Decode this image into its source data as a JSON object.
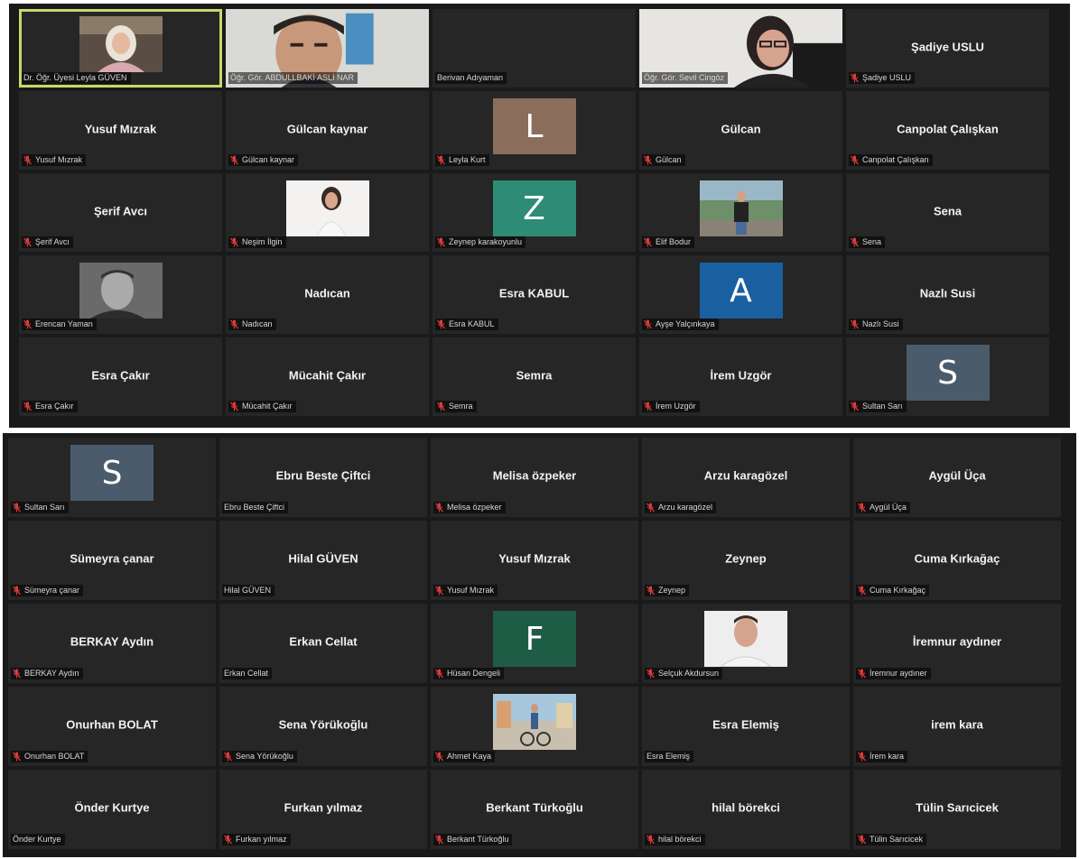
{
  "top_grid": [
    {
      "name": "",
      "label": "Dr. Öğr. Üyesi Leyla GÜVEN",
      "muted": false,
      "media": "photo",
      "active": true
    },
    {
      "name": "",
      "label": "Öğr. Gör. ABDULLBAKİ ASLİ NAR",
      "muted": false,
      "media": "video"
    },
    {
      "name": "",
      "label": "Berivan Adıyaman",
      "muted": false,
      "media": "none"
    },
    {
      "name": "",
      "label": "Öğr. Gör. Sevil Cingöz",
      "muted": false,
      "media": "video"
    },
    {
      "name": "Şadiye USLU",
      "label": "Şadiye USLU",
      "muted": true,
      "media": "none"
    },
    {
      "name": "Yusuf Mızrak",
      "label": "Yusuf Mızrak",
      "muted": true,
      "media": "none"
    },
    {
      "name": "Gülcan kaynar",
      "label": "Gülcan kaynar",
      "muted": true,
      "media": "none"
    },
    {
      "name": "",
      "label": "Leyla Kurt",
      "muted": true,
      "media": "initial",
      "initial": "L",
      "color": "#8b6d5c"
    },
    {
      "name": "Gülcan",
      "label": "Gülcan",
      "muted": true,
      "media": "none"
    },
    {
      "name": "Canpolat Çalışkan",
      "label": "Canpolat Çalışkan",
      "muted": true,
      "media": "none"
    },
    {
      "name": "Şerif Avcı",
      "label": "Şerif Avcı",
      "muted": true,
      "media": "none"
    },
    {
      "name": "",
      "label": "Neşim İlgin",
      "muted": true,
      "media": "photo"
    },
    {
      "name": "",
      "label": "Zeynep karakoyunlu",
      "muted": true,
      "media": "initial",
      "initial": "Z",
      "color": "#2e8b76"
    },
    {
      "name": "",
      "label": "Elif Bodur",
      "muted": true,
      "media": "photo"
    },
    {
      "name": "Sena",
      "label": "Sena",
      "muted": true,
      "media": "none"
    },
    {
      "name": "",
      "label": "Erencan Yaman",
      "muted": true,
      "media": "photo"
    },
    {
      "name": "Nadıcan",
      "label": "Nadıcan",
      "muted": true,
      "media": "none"
    },
    {
      "name": "Esra KABUL",
      "label": "Esra KABUL",
      "muted": true,
      "media": "none"
    },
    {
      "name": "",
      "label": "Ayşe Yalçınkaya",
      "muted": true,
      "media": "initial",
      "initial": "A",
      "color": "#1a5fa0"
    },
    {
      "name": "Nazlı Susi",
      "label": "Nazlı Susi",
      "muted": true,
      "media": "none"
    },
    {
      "name": "Esra Çakır",
      "label": "Esra Çakır",
      "muted": true,
      "media": "none"
    },
    {
      "name": "Mücahit Çakır",
      "label": "Mücahit Çakır",
      "muted": true,
      "media": "none"
    },
    {
      "name": "Semra",
      "label": "Semra",
      "muted": true,
      "media": "none"
    },
    {
      "name": "İrem Uzgör",
      "label": "İrem Uzgör",
      "muted": true,
      "media": "none"
    },
    {
      "name": "",
      "label": "Sultan Sarı",
      "muted": true,
      "media": "initial",
      "initial": "S",
      "color": "#4a5c6b"
    }
  ],
  "bottom_grid": [
    {
      "name": "",
      "label": "Sultan Sarı",
      "muted": true,
      "media": "initial",
      "initial": "S",
      "color": "#4a5c6b"
    },
    {
      "name": "Ebru Beste Çiftci",
      "label": "Ebru Beste Çiftci",
      "muted": false,
      "media": "none"
    },
    {
      "name": "Melisa özpeker",
      "label": "Melisa özpeker",
      "muted": true,
      "media": "none"
    },
    {
      "name": "Arzu karagözel",
      "label": "Arzu karagözel",
      "muted": true,
      "media": "none"
    },
    {
      "name": "Aygül Üça",
      "label": "Aygül Üça",
      "muted": true,
      "media": "none"
    },
    {
      "name": "Sümeyra çanar",
      "label": "Sümeyra çanar",
      "muted": true,
      "media": "none"
    },
    {
      "name": "Hilal GÜVEN",
      "label": "Hilal GÜVEN",
      "muted": false,
      "media": "none"
    },
    {
      "name": "Yusuf Mızrak",
      "label": "Yusuf Mızrak",
      "muted": true,
      "media": "none"
    },
    {
      "name": "Zeynep",
      "label": "Zeynep",
      "muted": true,
      "media": "none"
    },
    {
      "name": "Cuma Kırkağaç",
      "label": "Cuma Kırkağaç",
      "muted": true,
      "media": "none"
    },
    {
      "name": "BERKAY Aydın",
      "label": "BERKAY Aydın",
      "muted": true,
      "media": "none"
    },
    {
      "name": "Erkan Cellat",
      "label": "Erkan Cellat",
      "muted": false,
      "media": "none"
    },
    {
      "name": "",
      "label": "Hüsan Dengeli",
      "muted": true,
      "media": "initial",
      "initial": "F",
      "color": "#1e5c45"
    },
    {
      "name": "",
      "label": "Selçuk Akdursun",
      "muted": true,
      "media": "photo"
    },
    {
      "name": "İremnur aydıner",
      "label": "İremnur aydıner",
      "muted": true,
      "media": "none"
    },
    {
      "name": "Onurhan BOLAT",
      "label": "Onurhan BOLAT",
      "muted": true,
      "media": "none"
    },
    {
      "name": "Sena Yörükoğlu",
      "label": "Sena Yörükoğlu",
      "muted": true,
      "media": "none"
    },
    {
      "name": "",
      "label": "Ahmet Kaya",
      "muted": true,
      "media": "photo"
    },
    {
      "name": "Esra Elemiş",
      "label": "Esra Elemiş",
      "muted": false,
      "media": "none"
    },
    {
      "name": "irem kara",
      "label": "İrem kara",
      "muted": true,
      "media": "none"
    },
    {
      "name": "Önder Kurtye",
      "label": "Önder Kurtye",
      "muted": false,
      "media": "none"
    },
    {
      "name": "Furkan yılmaz",
      "label": "Furkan yılmaz",
      "muted": true,
      "media": "none"
    },
    {
      "name": "Berkant Türkoğlu",
      "label": "Berkant Türkoğlu",
      "muted": true,
      "media": "none"
    },
    {
      "name": "hilal börekci",
      "label": "hilal börekci",
      "muted": true,
      "media": "none"
    },
    {
      "name": "Tülin Sarıcicek",
      "label": "Tülin Sarıcicek",
      "muted": true,
      "media": "none"
    }
  ]
}
